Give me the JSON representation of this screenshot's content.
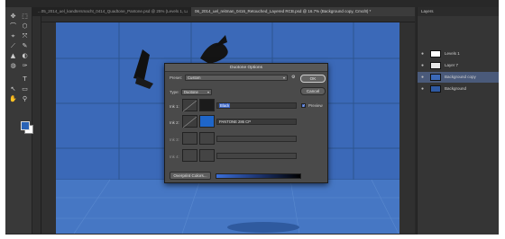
{
  "tabs": [
    {
      "label": "...05_2014_uel_kandtersmacht_0414_Quadtone_Pantone.psd @ 25% (Levels 1, Layer ...",
      "active": false
    },
    {
      "label": "06_2014_uel_reitman_0416_Retouched_Layered RCB.psd @ 16.7% (Background copy, Cmc/8) *",
      "active": true
    }
  ],
  "tools": [
    "✥",
    "⬚",
    "⌒",
    "⬡",
    "⌖",
    "⤧",
    "⟋",
    "✎",
    "▲",
    "◐",
    "◍",
    "✑",
    "T",
    "↖",
    "▭",
    "✋",
    "⚲"
  ],
  "layers_panel": {
    "title": "Layers",
    "layers": [
      {
        "name": "Levels 1",
        "thumb_color": "#ffffff",
        "selected": false
      },
      {
        "name": "Layer 7",
        "thumb_color": "#e8e8e8",
        "selected": false
      },
      {
        "name": "Background copy",
        "thumb_color": "#3b69b8",
        "selected": true
      },
      {
        "name": "Background",
        "thumb_color": "#2f5aa3",
        "selected": false
      }
    ]
  },
  "dialog": {
    "title": "Duotone Options",
    "preset_label": "Preset:",
    "preset_value": "Custom",
    "type_label": "Type:",
    "type_value": "Duotone",
    "ok_label": "OK",
    "cancel_label": "Cancel",
    "preview_label": "Preview",
    "preview_checked": true,
    "inks": [
      {
        "label": "Ink 1:",
        "swatch": "#1b1b1b",
        "name": "Black",
        "enabled": true
      },
      {
        "label": "Ink 2:",
        "swatch": "#1f66c9",
        "name": "PANTONE 286 CP",
        "enabled": true
      },
      {
        "label": "Ink 3:",
        "swatch": "#444444",
        "name": "",
        "enabled": false
      },
      {
        "label": "Ink 4:",
        "swatch": "#444444",
        "name": "",
        "enabled": false
      }
    ],
    "overprint_label": "Overprint Colors..."
  },
  "colors": {
    "photo_blue": "#3b69b8",
    "accent": "#3a64c4"
  }
}
